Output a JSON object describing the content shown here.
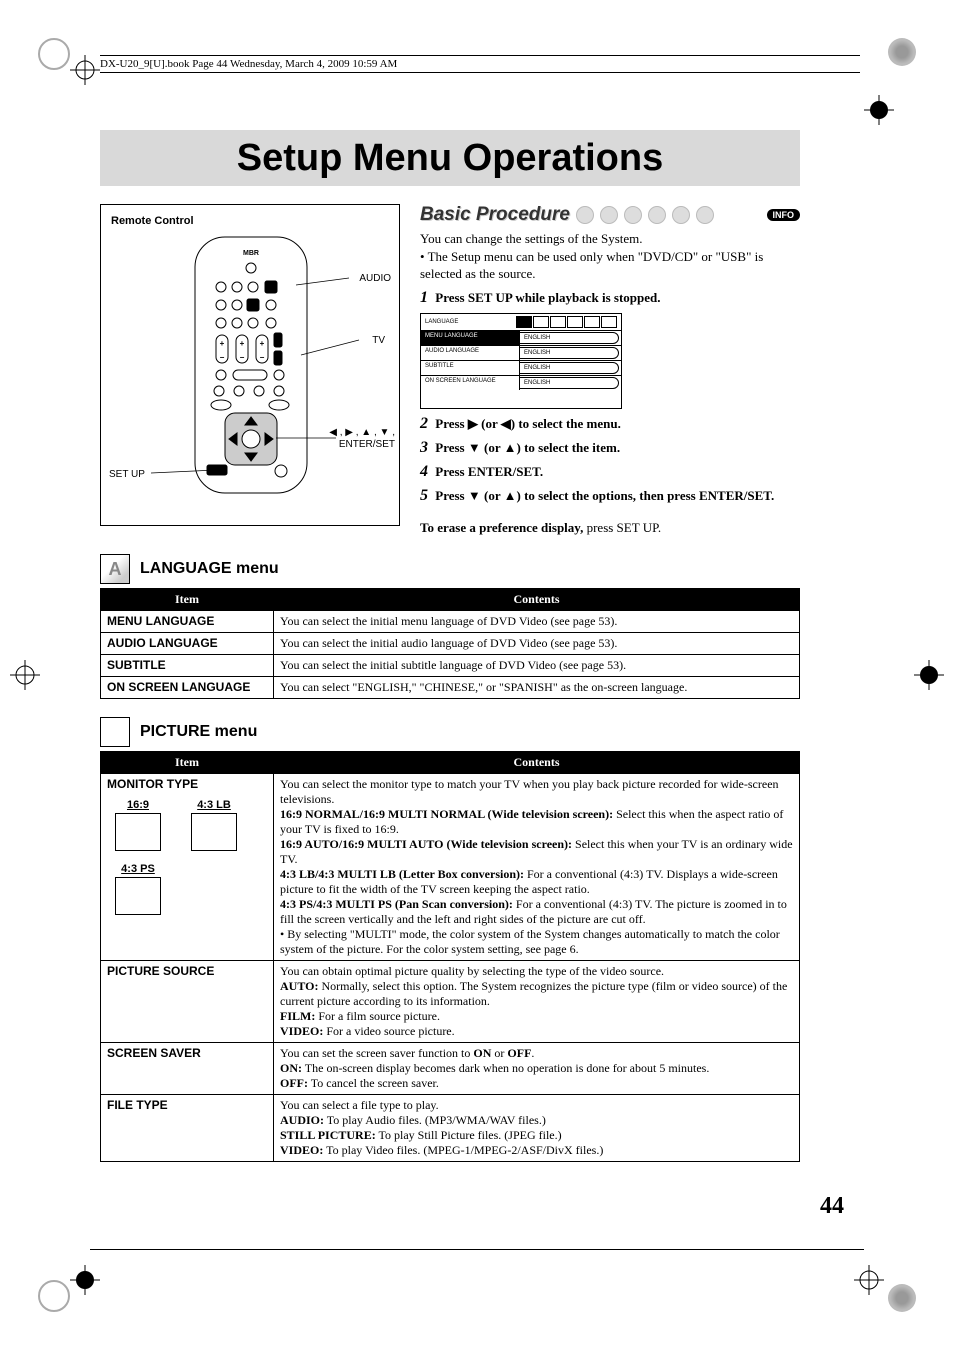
{
  "book_header": "DX-U20_9[U].book  Page 44  Wednesday, March 4, 2009  10:59 AM",
  "page_title": "Setup Menu Operations",
  "page_number": "44",
  "remote": {
    "title": "Remote Control",
    "labels": {
      "audio": "AUDIO",
      "tv": "TV",
      "arrows": "◀ , ▶ , ▲ , ▼ ,",
      "enter": "ENTER/SET",
      "setup": "SET UP"
    }
  },
  "basic": {
    "heading": "Basic Procedure",
    "info_pill": "INFO",
    "intro1": "You can change the settings of the System.",
    "intro2": "The Setup menu can be used only when \"DVD/CD\" or \"USB\" is selected as the source.",
    "steps": [
      {
        "n": "1",
        "text_b": "Press SET UP while playback is stopped."
      },
      {
        "n": "2",
        "pre": "Press ",
        "sym": "▶",
        "mid": " (or ",
        "sym2": "◀",
        "post": ") to select the menu.",
        "bold_all": true
      },
      {
        "n": "3",
        "pre": "Press ",
        "sym": "▼",
        "mid": " (or ",
        "sym2": "▲",
        "post": ") to select the item.",
        "bold_all": true
      },
      {
        "n": "4",
        "text_b": "Press ENTER/SET."
      },
      {
        "n": "5",
        "pre": "Press ",
        "sym": "▼",
        "mid": " (or ",
        "sym2": "▲",
        "post": ") to select the options, then press ENTER/SET.",
        "bold_all": true
      }
    ],
    "erase_b": "To erase a preference display,",
    "erase_rest": " press SET UP."
  },
  "osd": {
    "title": "LANGUAGE",
    "rows": [
      {
        "k": "MENU LANGUAGE",
        "v": "ENGLISH"
      },
      {
        "k": "AUDIO LANGUAGE",
        "v": "ENGLISH"
      },
      {
        "k": "SUBTITLE",
        "v": "ENGLISH"
      },
      {
        "k": "ON SCREEN LANGUAGE",
        "v": "ENGLISH"
      }
    ]
  },
  "language_menu": {
    "heading": "LANGUAGE menu",
    "cols": [
      "Item",
      "Contents"
    ],
    "rows": [
      {
        "item": "MENU LANGUAGE",
        "contents": "You can select the initial menu language of DVD Video (see page 53)."
      },
      {
        "item": "AUDIO LANGUAGE",
        "contents": "You can select the initial audio language of DVD Video (see page 53)."
      },
      {
        "item": "SUBTITLE",
        "contents": "You can select the initial subtitle language of DVD Video (see page 53)."
      },
      {
        "item": "ON SCREEN LANGUAGE",
        "contents": "You can select \"ENGLISH,\" \"CHINESE,\" or \"SPANISH\" as the on-screen language."
      }
    ]
  },
  "picture_menu": {
    "heading": "PICTURE menu",
    "cols": [
      "Item",
      "Contents"
    ],
    "monitor": {
      "item": "MONITOR TYPE",
      "sub": {
        "a": "16:9",
        "b": "4:3 LB",
        "c": "4:3 PS"
      },
      "c_intro": "You can select the monitor type to match your TV when you play back picture recorded for wide-screen televisions.",
      "l1b": "16:9 NORMAL/16:9 MULTI NORMAL (Wide television screen):",
      "l1": " Select this when the aspect ratio of your TV is fixed to 16:9.",
      "l2b": "16:9 AUTO/16:9 MULTI AUTO (Wide television screen):",
      "l2": " Select this when your TV is an ordinary wide TV.",
      "l3b": "4:3 LB/4:3 MULTI LB (Letter Box conversion):",
      "l3": " For a conventional (4:3) TV. Displays a wide-screen picture to fit the width of the TV screen keeping the aspect ratio.",
      "l4b": "4:3 PS/4:3 MULTI PS (Pan Scan conversion):",
      "l4": " For a conventional (4:3) TV. The picture is zoomed in to fill the screen vertically and the left and right sides of the picture are cut off.",
      "l5": "• By selecting \"MULTI\" mode, the color system of the System changes automatically to match the color system of the picture. For the color system setting, see page 6."
    },
    "picture_source": {
      "item": "PICTURE SOURCE",
      "c_intro": "You can obtain optimal picture quality by selecting the type of the video source.",
      "l1b": "AUTO:",
      "l1": " Normally, select this option. The System recognizes the picture type (film or video source) of the current picture according to its information.",
      "l2b": "FILM:",
      "l2": " For a film source picture.",
      "l3b": "VIDEO:",
      "l3": " For a video source picture."
    },
    "screen_saver": {
      "item": "SCREEN SAVER",
      "c_intro_pre": "You can set the screen saver function to ",
      "c_intro_b1": "ON",
      "c_intro_mid": " or ",
      "c_intro_b2": "OFF",
      "c_intro_post": ".",
      "l1b": "ON:",
      "l1": " The on-screen display becomes dark when no operation is done for about 5 minutes.",
      "l2b": "OFF:",
      "l2": " To cancel the screen saver."
    },
    "file_type": {
      "item": "FILE TYPE",
      "c_intro": "You can select a file type to play.",
      "l1b": "AUDIO:",
      "l1": " To play Audio files. (MP3/WMA/WAV files.)",
      "l2b": "STILL PICTURE:",
      "l2": " To play Still Picture files. (JPEG file.)",
      "l3b": "VIDEO:",
      "l3": " To play Video files. (MPEG-1/MPEG-2/ASF/DivX files.)"
    }
  }
}
